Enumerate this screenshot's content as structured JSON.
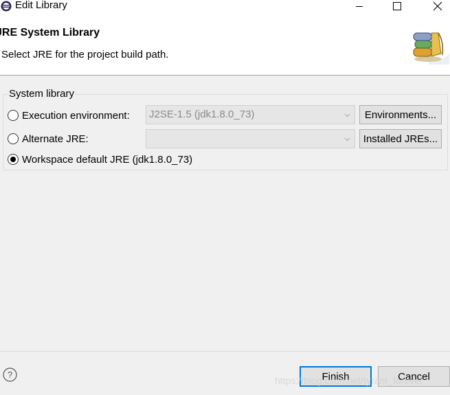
{
  "window": {
    "title": "Edit Library",
    "controls": {
      "minimize": "minimize",
      "maximize": "maximize",
      "close": "close"
    }
  },
  "banner": {
    "title": "JRE System Library",
    "description": "Select JRE for the project build path.",
    "image": "library-books-icon"
  },
  "group": {
    "legend": "System library",
    "options": [
      {
        "label": "Execution environment:",
        "checked": false,
        "combo_value": "J2SE-1.5 (jdk1.8.0_73)",
        "button": "Environments..."
      },
      {
        "label": "Alternate JRE:",
        "checked": false,
        "combo_value": "",
        "button": "Installed JREs..."
      },
      {
        "label": "Workspace default JRE (jdk1.8.0_73)",
        "checked": true
      }
    ]
  },
  "footer": {
    "help_icon": "help-icon",
    "finish_label": "Finish",
    "cancel_label": "Cancel",
    "watermark": "https://blog.csdn.net/tyrant_forever"
  },
  "colors": {
    "background": "#f0f0f0",
    "banner_background": "#ffffff",
    "default_button_border": "#0078d7",
    "disabled_combo": "#e6e6e6"
  }
}
